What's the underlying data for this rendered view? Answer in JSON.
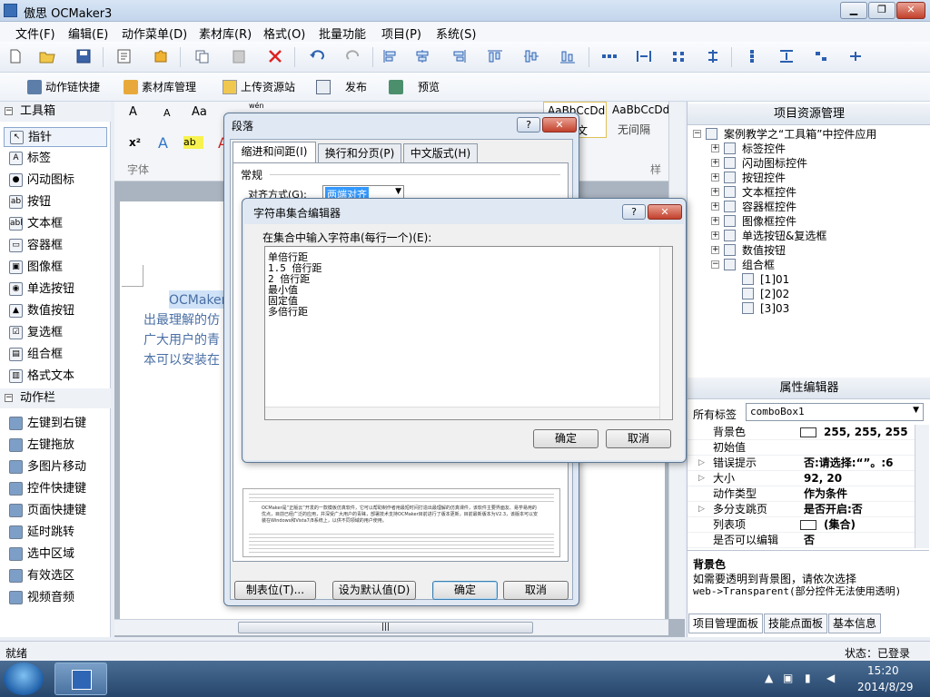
{
  "window": {
    "title": "傲思 OCMaker3",
    "btn_min": "▁",
    "btn_max": "❐",
    "btn_close": "✕"
  },
  "menu": [
    "文件(F)",
    "编辑(E)",
    "动作菜单(D)",
    "素材库(R)",
    "格式(O)",
    "批量功能",
    "项目(P)",
    "系统(S)"
  ],
  "toolbar2": {
    "item1": "动作链快捷",
    "item2": "素材库管理",
    "item3": "上传资源站",
    "item4": "发布",
    "item5": "预览"
  },
  "toolbox": {
    "section1": "工具箱",
    "items1": [
      "指针",
      "标签",
      "闪动图标",
      "按钮",
      "文本框",
      "容器框",
      "图像框",
      "单选按钮",
      "数值按钮",
      "复选框",
      "组合框",
      "格式文本"
    ],
    "icons1": [
      "↖",
      "A",
      "●",
      "ab",
      "abl",
      "▭",
      "▣",
      "◉",
      "▲",
      "☑",
      "▤",
      "▥"
    ],
    "section2": "动作栏",
    "items2": [
      "左键到右键",
      "左键拖放",
      "多图片移动",
      "控件快捷键",
      "页面快捷键",
      "延时跳转",
      "选中区域",
      "有效选区",
      "视频音频"
    ]
  },
  "ribbon": {
    "font_size_up": "A",
    "font_size_down": "A",
    "aa": "Aa",
    "wen": "wén",
    "x2": "x²",
    "font_group": "字体",
    "style_group": "样",
    "style1": "AaBbCcDd",
    "style1_label": "文",
    "style2": "AaBbCcDd",
    "style2_label": "无间隔"
  },
  "document": {
    "line0": "OCMaker：",
    "line1": "出最理解的仿",
    "line2": "广大用户的青",
    "line3": "本可以安装在"
  },
  "project_panel": {
    "title": "项目资源管理",
    "root": "案例教学之“工具箱”中控件应用",
    "nodes": [
      "标签控件",
      "闪动图标控件",
      "按钮控件",
      "文本框控件",
      "容器框控件",
      "图像框控件",
      "单选按钮&复选框",
      "数值按钮",
      "组合框"
    ],
    "leaves": [
      "[1]01",
      "[2]02",
      "[3]03"
    ]
  },
  "property_panel": {
    "title": "属性编辑器",
    "filter_label": "所有标签",
    "filter_value": "comboBox1",
    "rows": [
      {
        "k": "背景色",
        "v": "255, 255, 255"
      },
      {
        "k": "初始值",
        "v": ""
      },
      {
        "k": "错误提示",
        "v": "否:请选择:“”。:6"
      },
      {
        "k": "大小",
        "v": "92, 20"
      },
      {
        "k": "动作类型",
        "v": "作为条件"
      },
      {
        "k": "多分支跳页",
        "v": "是否开启:否"
      },
      {
        "k": "列表项",
        "v": "(集合)"
      },
      {
        "k": "是否可以编辑",
        "v": "否"
      }
    ],
    "desc_title": "背景色",
    "desc_text1": "如需要透明到背景图，请依次选择",
    "desc_text2": "web->Transparent(部分控件无法使用透明)"
  },
  "bottom_tabs": [
    "项目管理面板",
    "技能点面板",
    "基本信息"
  ],
  "status": {
    "left": "就绪",
    "right": "状态：已登录"
  },
  "taskbar": {
    "time": "15:20",
    "date": "2014/8/29"
  },
  "paragraph_dialog": {
    "title": "段落",
    "tabs": [
      "缩进和间距(I)",
      "换行和分页(P)",
      "中文版式(H)"
    ],
    "section": "常规",
    "align_label": "对齐方式(G):",
    "align_value": "两端对齐",
    "btn_tabs": "制表位(T)...",
    "btn_default": "设为默认值(D)",
    "btn_ok": "确定",
    "btn_cancel": "取消",
    "preview_caption": "OCMaker是“正版云”开发的一款模板仿真软件，它可以帮助制作者用最短时间打造出最理解的仿真课件，该软件主要界面友、易学易用的优点，目前已经广泛的应用，并深受广大用户的青睐，部署技术支持OCMaker目前进行了版本更新，目前最新版本为V2.3，该版本可以安装在Windows和Vista7/8系统上，以供不同领域的用户使用。"
  },
  "string_editor": {
    "title": "字符串集合编辑器",
    "prompt": "在集合中输入字符串(每行一个)(E):",
    "lines": [
      "单倍行距",
      "1.5 倍行距",
      "2 倍行距",
      "最小值",
      "固定值",
      "多倍行距"
    ],
    "btn_ok": "确定",
    "btn_cancel": "取消"
  },
  "colors": {
    "accent": "#3c7fb1",
    "close_red": "#c2402b",
    "selection": "#cfe2f7"
  }
}
